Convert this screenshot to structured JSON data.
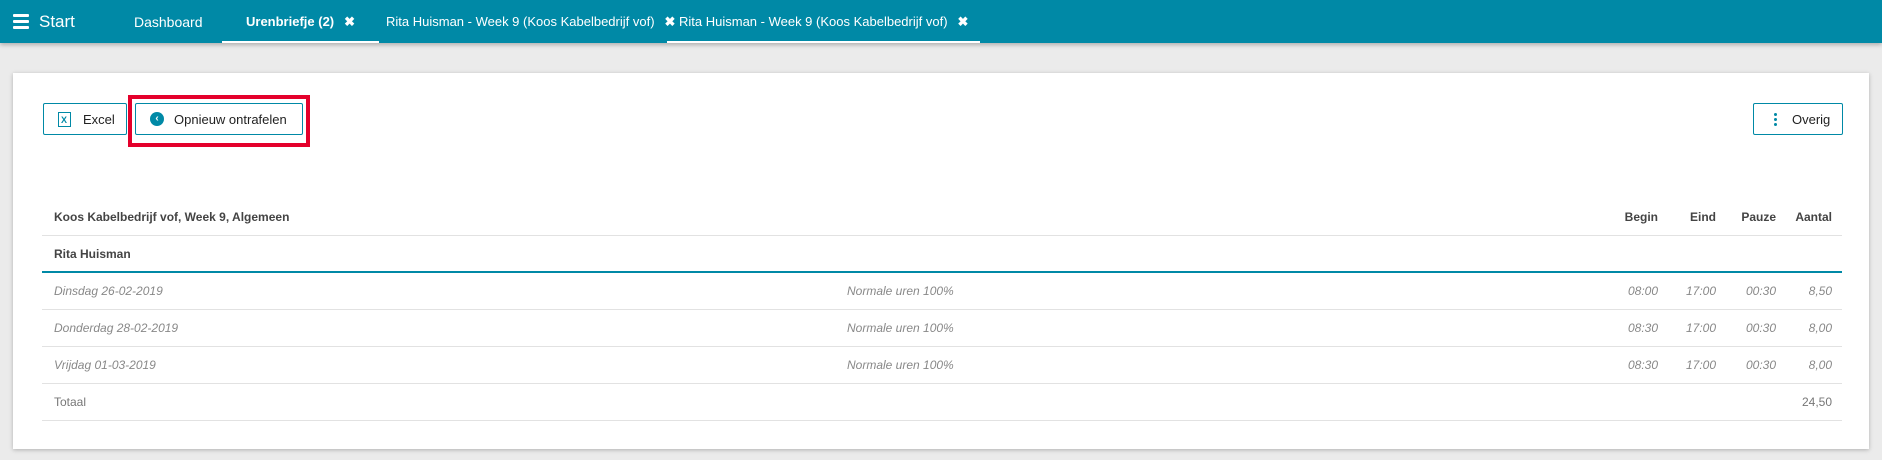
{
  "topbar": {
    "start_label": "Start",
    "tabs": [
      {
        "label": "Dashboard"
      },
      {
        "label": "Urenbriefje (2)"
      },
      {
        "label": "Rita Huisman - Week 9 (Koos Kabelbedrijf vof)"
      },
      {
        "label": "Rita Huisman - Week 9 (Koos Kabelbedrijf vof)"
      }
    ],
    "close_glyph": "✖"
  },
  "toolbar": {
    "excel_label": "Excel",
    "reunravel_label": "Opnieuw ontrafelen",
    "more_label": "Overig"
  },
  "table": {
    "header": {
      "title": "Koos Kabelbedrijf vof, Week 9, Algemeen",
      "begin": "Begin",
      "end": "Eind",
      "pause": "Pauze",
      "count": "Aantal"
    },
    "group": "Rita Huisman",
    "rows": [
      {
        "day": "Dinsdag 26-02-2019",
        "type": "Normale uren 100%",
        "begin": "08:00",
        "end": "17:00",
        "pause": "00:30",
        "count": "8,50"
      },
      {
        "day": "Donderdag 28-02-2019",
        "type": "Normale uren 100%",
        "begin": "08:30",
        "end": "17:00",
        "pause": "00:30",
        "count": "8,00"
      },
      {
        "day": "Vrijdag 01-03-2019",
        "type": "Normale uren 100%",
        "begin": "08:30",
        "end": "17:00",
        "pause": "00:30",
        "count": "8,00"
      }
    ],
    "total_label": "Totaal",
    "total_value": "24,50"
  },
  "colors": {
    "accent": "#0089a6",
    "highlight": "#e4002b"
  }
}
